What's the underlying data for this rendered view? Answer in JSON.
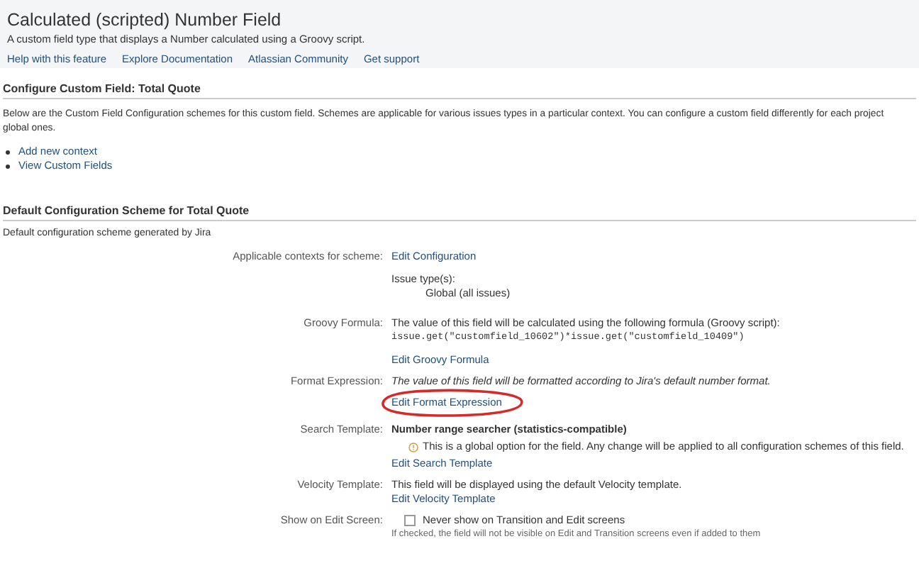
{
  "header": {
    "title": "Calculated (scripted) Number Field",
    "description": "A custom field type that displays a Number calculated using a Groovy script.",
    "links": [
      "Help with this feature",
      "Explore Documentation",
      "Atlassian Community",
      "Get support"
    ]
  },
  "configure_section": {
    "heading": "Configure Custom Field: Total Quote",
    "description_lines": [
      "Below are the Custom Field Configuration schemes for this custom field. Schemes are applicable for various issues types in a particular context. You can configure a custom field differently for each project",
      "global ones."
    ],
    "links": [
      "Add new context",
      "View Custom Fields"
    ]
  },
  "scheme_section": {
    "heading": "Default Configuration Scheme for Total Quote",
    "description": "Default configuration scheme generated by Jira",
    "rows": [
      {
        "label": "Applicable contexts for scheme:",
        "items": [
          {
            "kind": "link",
            "text": "Edit Configuration"
          },
          {
            "kind": "spacer"
          },
          {
            "kind": "text",
            "text": "Issue type(s):"
          },
          {
            "kind": "indent",
            "text": "Global (all issues)"
          },
          {
            "kind": "spacer"
          }
        ]
      },
      {
        "label": "Groovy Formula:",
        "items": [
          {
            "kind": "text",
            "text": "The value of this field will be calculated using the following formula (Groovy script):"
          },
          {
            "kind": "code",
            "text": "issue.get(\"customfield_10602\")*issue.get(\"customfield_10409\")"
          },
          {
            "kind": "spacer"
          },
          {
            "kind": "link",
            "text": "Edit Groovy Formula"
          }
        ]
      },
      {
        "label": "Format Expression:",
        "items": [
          {
            "kind": "italic",
            "text": "The value of this field will be formatted according to Jira's default number format."
          },
          {
            "kind": "link",
            "text": "Edit Format Expression",
            "circled": true
          }
        ]
      },
      {
        "label": "Search Template:",
        "items": [
          {
            "kind": "bold",
            "text": "Number range searcher (statistics-compatible)"
          },
          {
            "kind": "note",
            "text": "This is a global option for the field. Any change will be applied to all configuration schemes of this field."
          },
          {
            "kind": "link",
            "text": "Edit Search Template"
          }
        ]
      },
      {
        "label": "Velocity Template:",
        "items": [
          {
            "kind": "text",
            "text": "This field will be displayed using the default Velocity template."
          },
          {
            "kind": "link",
            "text": "Edit Velocity Template"
          }
        ]
      },
      {
        "label": "Show on Edit Screen:",
        "items": [
          {
            "kind": "checkbox",
            "text": "Never show on Transition and Edit screens",
            "checked": false
          },
          {
            "kind": "hint",
            "text": "If checked, the field will not be visible on Edit and Transition screens even if added to them"
          }
        ]
      }
    ]
  }
}
